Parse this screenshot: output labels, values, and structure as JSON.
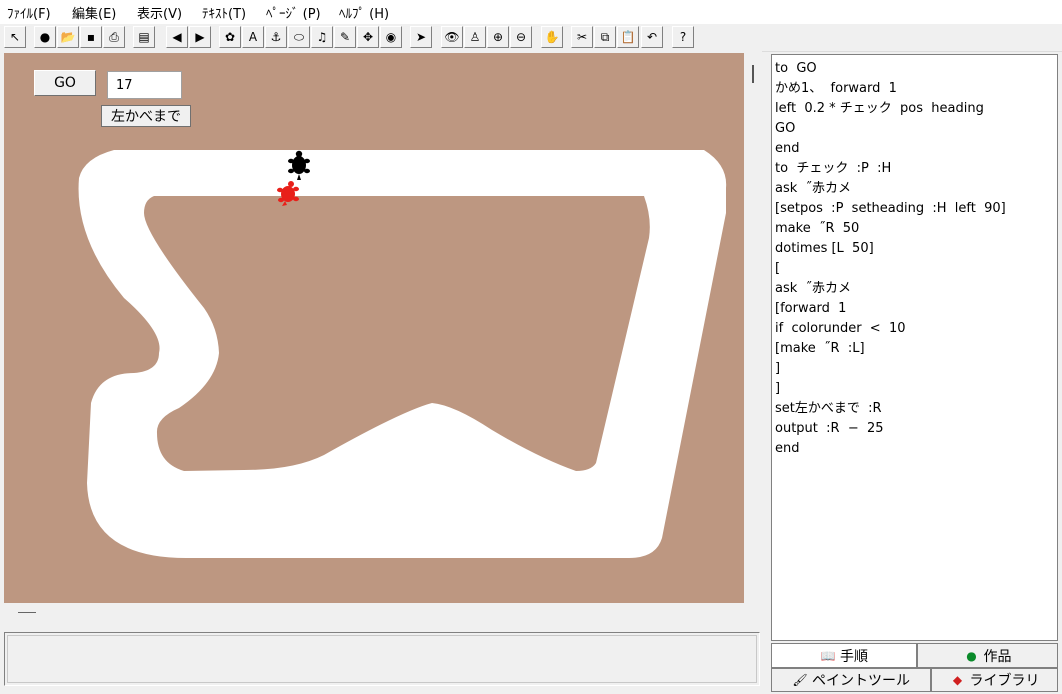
{
  "menu": [
    {
      "label": "ﾌｧｲﾙ(F)"
    },
    {
      "label": "編集(E)"
    },
    {
      "label": "表示(V)"
    },
    {
      "label": "ﾃｷｽﾄ(T)"
    },
    {
      "label": "ﾍﾟｰｼﾞ (P)"
    },
    {
      "label": "ﾍﾙﾌﾟ (H)"
    }
  ],
  "toolbar": [
    {
      "icon": "select-arrow-icon",
      "glyph": "↖"
    },
    {
      "icon": "new-page-icon",
      "glyph": "●"
    },
    {
      "icon": "open-folder-icon",
      "glyph": "📂"
    },
    {
      "icon": "save-icon",
      "glyph": "▪"
    },
    {
      "icon": "print-icon",
      "glyph": "⎙"
    },
    {
      "icon": "pages-icon",
      "glyph": "▤"
    },
    {
      "icon": "previous-page-icon",
      "glyph": "◀"
    },
    {
      "icon": "next-page-icon",
      "glyph": "▶"
    },
    {
      "icon": "new-turtle-icon",
      "glyph": "✿"
    },
    {
      "icon": "text-box-icon",
      "glyph": "A"
    },
    {
      "icon": "slider-icon",
      "glyph": "⚓"
    },
    {
      "icon": "button-icon",
      "glyph": "⬭"
    },
    {
      "icon": "music-icon",
      "glyph": "♫"
    },
    {
      "icon": "shape-icon",
      "glyph": "✎"
    },
    {
      "icon": "animation-icon",
      "glyph": "✥"
    },
    {
      "icon": "turtle-graphics-icon",
      "glyph": "◉"
    },
    {
      "icon": "pointer-icon",
      "glyph": "➤"
    },
    {
      "icon": "eye-icon",
      "glyph": "👁"
    },
    {
      "icon": "stamp-icon",
      "glyph": "♙"
    },
    {
      "icon": "zoom-in-icon",
      "glyph": "⊕"
    },
    {
      "icon": "zoom-out-icon",
      "glyph": "⊖"
    },
    {
      "icon": "stop-hand-icon",
      "glyph": "✋"
    },
    {
      "icon": "cut-icon",
      "glyph": "✂"
    },
    {
      "icon": "copy-icon",
      "glyph": "⧉"
    },
    {
      "icon": "paste-icon",
      "glyph": "📋"
    },
    {
      "icon": "undo-icon",
      "glyph": "↶"
    },
    {
      "icon": "help-icon",
      "glyph": "?"
    }
  ],
  "canvas": {
    "go_button": "GO",
    "value_box": "17",
    "left_wall_button": "左かべまで",
    "background_color": "#bd9781",
    "track_color": "#ffffff"
  },
  "procedures": [
    "to  GO",
    "かめ1、  forward  1",
    "left  0.2 * チェック  pos  heading",
    "GO",
    "end",
    "to  チェック  :P  :H",
    "ask  ˝赤カメ",
    "[setpos  :P  setheading  :H  left  90]",
    "make  ˝R  50",
    "dotimes [L  50]",
    "[",
    "ask  ˝赤カメ",
    "[forward  1",
    "if  colorunder  <  10",
    "[make  ˝R  :L]",
    "]",
    "]",
    "set左かべまで  :R",
    "output  :R  −  25",
    "end"
  ],
  "tabs": {
    "procedures": "手順",
    "projects": "作品",
    "paint_tools": "ペイントツール",
    "library": "ライブラリ"
  }
}
